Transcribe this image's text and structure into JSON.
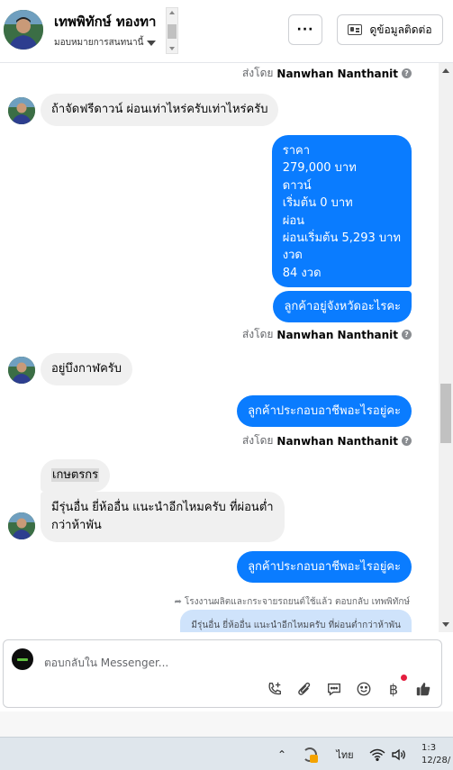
{
  "header": {
    "contact_name": "เทพพิทักษ์ ทองทา",
    "assignment": "มอบหมายการสนทนานี้",
    "more_label": "···",
    "contact_info_label": "ดูข้อมูลติดต่อ"
  },
  "messages": {
    "sent_by_prefix": "ส่งโดย",
    "agent_name": "Nanwhan Nanthanit",
    "msg_down_payment": "ถ้าจัดฟรีดาวน์ ผ่อนเท่าไหร่ครับเท่าไหร่ครับ",
    "price_block": [
      "ราคา",
      "279,000 บาท",
      "ดาวน์",
      "เริ่มต้น 0 บาท",
      "ผ่อน",
      "ผ่อนเริ่มต้น 5,293 บาท",
      "งวด",
      "84 งวด"
    ],
    "q_province": "ลูกค้าอยู่จังหวัดอะไรคะ",
    "msg_location": "อยู่บึงกาฬครับ",
    "q_occupation": "ลูกค้าประกอบอาชีพอะไรอยู่คะ",
    "msg_farmer": "เกษตรกร",
    "msg_other_brand_line1": "มีรุ่นอื่น ยี่ห้ออื่น แนะนำอีกไหมครับ ที่ผ่อนต่ำ",
    "msg_other_brand_line2": "กว่าห้าพัน",
    "q_occupation_2": "ลูกค้าประกอบอาชีพอะไรอยู่คะ",
    "reply_note": "โรงงานผลิตและกระจายรถยนต์ใช้แล้ว ตอบกลับ เทพพิทักษ์",
    "reply_quote": "มีรุ่นอื่น ยี่ห้ออื่น แนะนำอีกไหมครับ ที่ผ่อนต่ำกว่าห้าพัน"
  },
  "composer": {
    "placeholder": "ตอบกลับใน Messenger..."
  },
  "taskbar": {
    "language": "ไทย",
    "time": "1:3",
    "date": "12/28/"
  },
  "colors": {
    "outgoing_bubble": "#0a7cff",
    "incoming_bubble": "#f0f0f0",
    "notification_dot": "#e41e3f"
  },
  "icons": [
    "ellipsis-icon",
    "contact-card-icon",
    "help-icon",
    "add-call-icon",
    "attachment-icon",
    "saved-reply-icon",
    "emoji-icon",
    "baht-icon",
    "like-icon",
    "wifi-icon",
    "volume-icon",
    "sync-icon"
  ]
}
